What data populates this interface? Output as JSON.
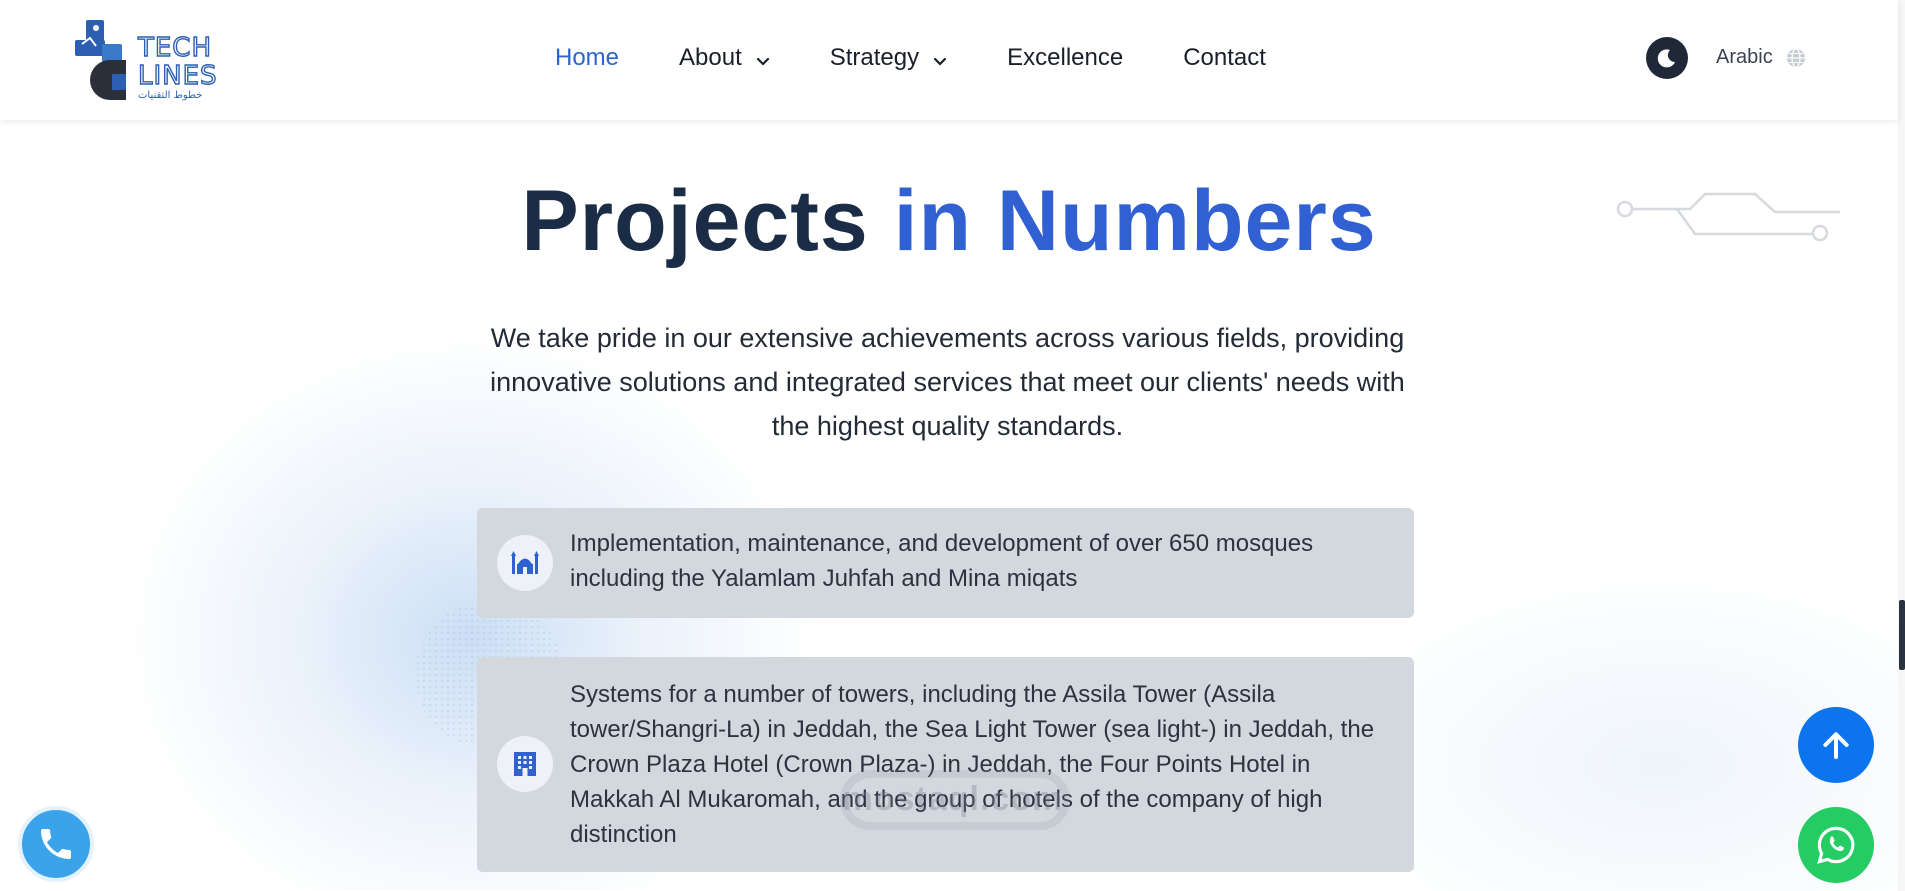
{
  "header": {
    "logo_text": "TECH LINES",
    "logo_subtext": "خطوط التقنيات",
    "nav": [
      {
        "label": "Home",
        "active": true,
        "has_dropdown": false
      },
      {
        "label": "About",
        "active": false,
        "has_dropdown": true
      },
      {
        "label": "Strategy",
        "active": false,
        "has_dropdown": true
      },
      {
        "label": "Excellence",
        "active": false,
        "has_dropdown": false
      },
      {
        "label": "Contact",
        "active": false,
        "has_dropdown": false
      }
    ],
    "theme_toggle_icon": "moon-icon",
    "language_label": "Arabic",
    "language_icon": "globe-icon"
  },
  "hero": {
    "title_main": "Projects ",
    "title_accent": "in Numbers",
    "intro": "We take pride in our extensive achievements across various fields, providing innovative solutions and integrated services that meet our clients' needs with the highest quality standards."
  },
  "cards": [
    {
      "icon": "mosque-icon",
      "text": "Implementation, maintenance, and development of over 650 mosques including the Yalamlam Juhfah and Mina miqats"
    },
    {
      "icon": "building-icon",
      "text": "Systems for a number of towers, including the Assila Tower (Assila tower/Shangri-La) in Jeddah, the Sea Light Tower (sea light-) in Jeddah, the Crown Plaza Hotel (Crown Plaza-) in Jeddah, the Four Points Hotel in Makkah Al Mukaromah, and the group of hotels of the company of high distinction"
    }
  ],
  "watermark": "mostaql.com",
  "floating": {
    "call_icon": "phone-icon",
    "top_icon": "arrow-up-icon",
    "whatsapp_icon": "whatsapp-icon"
  },
  "colors": {
    "accent": "#3160d2",
    "nav_active": "#2e66c8",
    "title_dark": "#1b2c46",
    "card_bg": "#d3d7de",
    "call_button": "#3aa3ea",
    "top_button": "#0d74f0",
    "whatsapp_button": "#24cc63"
  }
}
